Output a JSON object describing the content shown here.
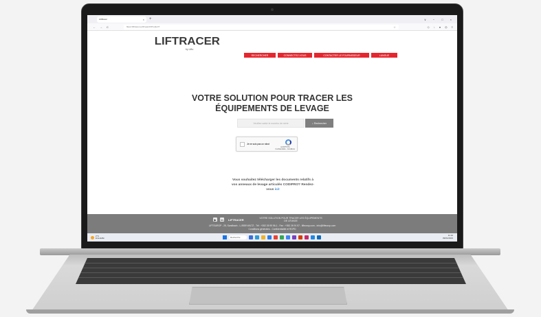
{
  "browser": {
    "tab_title": "LiftRacer",
    "tab_close": "×",
    "new_tab": "+",
    "url": "https://liftracer.eu/fr/search/ProductT",
    "window_controls": [
      "∨",
      "−",
      "□",
      "×"
    ],
    "nav_back": "←",
    "nav_forward": "→",
    "nav_reload": "C"
  },
  "header": {
    "logo": "LIFTRACER",
    "logo_sub": "by Lifto",
    "nav": [
      {
        "label": "RECHERCHER"
      },
      {
        "label": "CONNECTEZ-VOUS"
      },
      {
        "label": "CONTACTER LE FOURNISSEUR"
      },
      {
        "label": "LANGUE"
      }
    ]
  },
  "hero": {
    "line1": "VOTRE SOLUTION POUR TRACER LES",
    "line2": "ÉQUIPEMENTS DE LEVAGE"
  },
  "search": {
    "placeholder": "Veuillez saisir le numéro de série",
    "button": "Rechercher"
  },
  "captcha": {
    "label": "Je ne suis pas un robot",
    "brand": "reCAPTCHA",
    "terms": "Confidentialité - Conditions"
  },
  "promo": {
    "line1": "Vous souhaitez télécharger les documents relatifs à",
    "line2": "vos anneaux de levage articulés CODIPRO? Rendez-",
    "line3_prefix": "vous ",
    "link": "ici!"
  },
  "footer": {
    "icon_yt": "▶",
    "icon_in": "in",
    "logo": "LIFTRACER",
    "title": "VOTRE SOLUTION POUR TRACER LES ÉQUIPEMENTS DE LEVAGE",
    "address": "LIFTEUROP - 25, Sandbach - L-9559 WILTZ - Tél : +352 26 95 56-1 - Fax : +352 26 91 57 - lifteurop.com - info@lifteurop.com",
    "links": "Conditions générales - Confidentialité et RGPD"
  },
  "taskbar": {
    "weather_temp": "2°C",
    "weather_desc": "Ensoleillé",
    "search_label": "Recherche",
    "time": "11:10",
    "date": "09/01/2023",
    "apps": [
      {
        "color": "#3a6fd8"
      },
      {
        "color": "#2e9bd8"
      },
      {
        "color": "#f0b429"
      },
      {
        "color": "#2b7de9"
      },
      {
        "color": "#e94235"
      },
      {
        "color": "#34a853"
      },
      {
        "color": "#4285f4"
      },
      {
        "color": "#7b3fbf"
      },
      {
        "color": "#d83b01"
      },
      {
        "color": "#c72b6c"
      },
      {
        "color": "#1e88e5"
      },
      {
        "color": "#0f6cbd"
      }
    ]
  }
}
